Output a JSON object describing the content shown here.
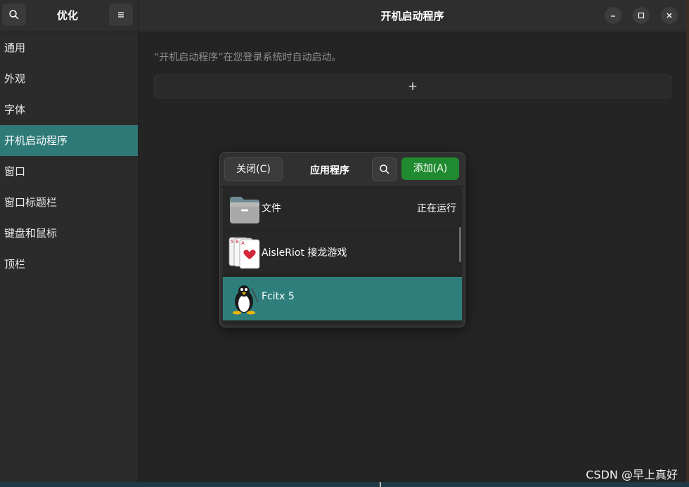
{
  "sidebar": {
    "title": "优化",
    "search_icon": "search-icon",
    "menu_icon": "hamburger-menu-icon",
    "items": [
      {
        "label": "通用"
      },
      {
        "label": "外观"
      },
      {
        "label": "字体"
      },
      {
        "label": "开机启动程序"
      },
      {
        "label": "窗口"
      },
      {
        "label": "窗口标题栏"
      },
      {
        "label": "键盘和鼠标"
      },
      {
        "label": "顶栏"
      }
    ],
    "active_index": 3
  },
  "main": {
    "title": "开机启动程序",
    "description": "“开机启动程序”在您登录系统时自动启动。",
    "add_symbol": "+"
  },
  "window_controls": {
    "minimize": "minimize-icon",
    "maximize": "maximize-icon",
    "close": "close-icon"
  },
  "dialog": {
    "close_label": "关闭(C)",
    "title": "应用程序",
    "add_label": "添加(A)",
    "apps": [
      {
        "name": "文件",
        "status": "正在运行",
        "icon": "folder-icon"
      },
      {
        "name": "AisleRiot 接龙游戏",
        "status": "",
        "icon": "playing-cards-icon"
      },
      {
        "name": "Fcitx 5",
        "status": "",
        "icon": "penguin-icon"
      }
    ],
    "selected_index": 2
  },
  "colors": {
    "accent": "#2e7a78",
    "add_button": "#1f8a2f",
    "background": "#242424",
    "sidebar": "#2b2b2b"
  },
  "watermark": "CSDN @早上真好"
}
